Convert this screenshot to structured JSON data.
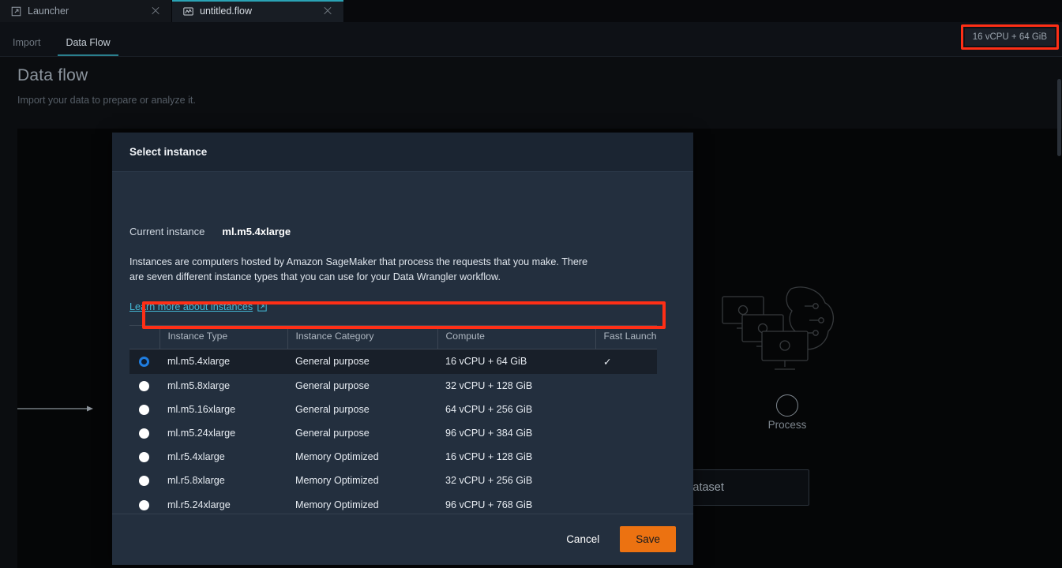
{
  "tabs": [
    {
      "label": "Launcher",
      "icon": "external-window-icon",
      "active": false
    },
    {
      "label": "untitled.flow",
      "icon": "flow-file-icon",
      "active": true
    }
  ],
  "subnav": {
    "items": [
      {
        "label": "Import",
        "active": false
      },
      {
        "label": "Data Flow",
        "active": true
      }
    ]
  },
  "kernel_badge": {
    "label": "16 vCPU + 64 GiB",
    "highlight_color": "#ff2f16"
  },
  "page": {
    "title": "Data flow",
    "subtitle": "Import your data to prepare or analyze it."
  },
  "canvas": {
    "process_node_label": "Process",
    "dataset_node_label": "le dataset"
  },
  "modal": {
    "title": "Select instance",
    "current_instance_label": "Current instance",
    "current_instance_value": "ml.m5.4xlarge",
    "description": "Instances are computers hosted by Amazon SageMaker that process the requests that you make. There are seven different instance types that you can use for your Data Wrangler workflow.",
    "learn_more_label": "Learn more about instances",
    "learn_more_icon": "external-link-icon",
    "table": {
      "columns": [
        "Instance Type",
        "Instance Category",
        "Compute",
        "Fast Launch"
      ],
      "rows": [
        {
          "selected": true,
          "type": "ml.m5.4xlarge",
          "category": "General purpose",
          "compute": "16 vCPU + 64 GiB",
          "fast_launch": "✓"
        },
        {
          "selected": false,
          "type": "ml.m5.8xlarge",
          "category": "General purpose",
          "compute": "32 vCPU + 128 GiB",
          "fast_launch": ""
        },
        {
          "selected": false,
          "type": "ml.m5.16xlarge",
          "category": "General purpose",
          "compute": "64 vCPU + 256 GiB",
          "fast_launch": ""
        },
        {
          "selected": false,
          "type": "ml.m5.24xlarge",
          "category": "General purpose",
          "compute": "96 vCPU + 384 GiB",
          "fast_launch": ""
        },
        {
          "selected": false,
          "type": "ml.r5.4xlarge",
          "category": "Memory Optimized",
          "compute": "16 vCPU + 128 GiB",
          "fast_launch": ""
        },
        {
          "selected": false,
          "type": "ml.r5.8xlarge",
          "category": "Memory Optimized",
          "compute": "32 vCPU + 256 GiB",
          "fast_launch": ""
        },
        {
          "selected": false,
          "type": "ml.r5.24xlarge",
          "category": "Memory Optimized",
          "compute": "96 vCPU + 768 GiB",
          "fast_launch": ""
        }
      ]
    },
    "footer": {
      "cancel_label": "Cancel",
      "save_label": "Save",
      "save_color": "#ec7211"
    }
  },
  "colors": {
    "accent_teal": "#2aa3b5",
    "link_teal": "#44b9d6",
    "modal_bg": "#232f3e",
    "annotation_red": "#ff2f16",
    "radio_blue": "#1f7de0"
  }
}
